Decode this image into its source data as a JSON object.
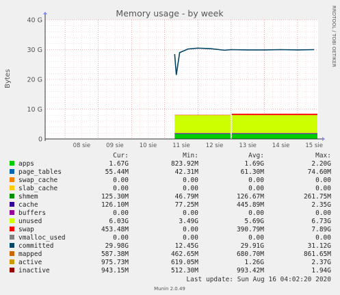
{
  "chart_data": {
    "type": "area",
    "title": "Memory usage - by week",
    "ylabel": "Bytes",
    "side_label": "RRDTOOL / TOBI OETIKER",
    "y_ticks": [
      "0",
      "10 G",
      "20 G",
      "30 G",
      "40 G"
    ],
    "ylim": [
      0,
      40
    ],
    "y_unit": "G",
    "x_ticks": [
      "08 sie",
      "09 sie",
      "10 sie",
      "11 sie",
      "12 sie",
      "13 sie",
      "14 sie",
      "15 sie"
    ],
    "grid": true,
    "stack": [
      {
        "name": "apps",
        "color": "#00cc00",
        "value": 1.67
      },
      {
        "name": "page_tables",
        "color": "#0066b3",
        "value": 0.055
      },
      {
        "name": "swap_cache",
        "color": "#ff8000",
        "value": 0.0
      },
      {
        "name": "slab_cache",
        "color": "#ffcc00",
        "value": 0.0
      },
      {
        "name": "shmem",
        "color": "#330099",
        "value": 0.125
      },
      {
        "name": "cache",
        "color": "#990099",
        "value": 0.126
      },
      {
        "name": "buffers",
        "color": "#ccff00",
        "value": 0.0
      },
      {
        "name": "unused",
        "color": "#ccff00",
        "value": 6.03
      },
      {
        "name": "swap",
        "color": "#ff0000",
        "value": 0.45
      }
    ],
    "committed_line": {
      "name": "committed",
      "color": "#004466",
      "values": [
        {
          "x": 11.3,
          "y": 28.5
        },
        {
          "x": 11.35,
          "y": 21.5
        },
        {
          "x": 11.45,
          "y": 29.0
        },
        {
          "x": 11.7,
          "y": 30.2
        },
        {
          "x": 12.0,
          "y": 30.5
        },
        {
          "x": 12.4,
          "y": 30.3
        },
        {
          "x": 12.8,
          "y": 29.8
        },
        {
          "x": 13.0,
          "y": 30.0
        },
        {
          "x": 13.5,
          "y": 29.9
        },
        {
          "x": 14.0,
          "y": 29.9
        },
        {
          "x": 14.5,
          "y": 30.0
        },
        {
          "x": 15.0,
          "y": 29.9
        },
        {
          "x": 15.5,
          "y": 30.0
        }
      ]
    }
  },
  "legend": {
    "headers": {
      "cur": "Cur:",
      "min": "Min:",
      "avg": "Avg:",
      "max": "Max:"
    },
    "rows": [
      {
        "name": "apps",
        "color": "#00cc00",
        "cur": "1.67G",
        "min": "823.92M",
        "avg": "1.69G",
        "max": "2.20G"
      },
      {
        "name": "page_tables",
        "color": "#0066b3",
        "cur": "55.44M",
        "min": "42.31M",
        "avg": "61.30M",
        "max": "74.60M"
      },
      {
        "name": "swap_cache",
        "color": "#ff8000",
        "cur": "0.00",
        "min": "0.00",
        "avg": "0.00",
        "max": "0.00"
      },
      {
        "name": "slab_cache",
        "color": "#ffcc00",
        "cur": "0.00",
        "min": "0.00",
        "avg": "0.00",
        "max": "0.00"
      },
      {
        "name": "shmem",
        "color": "#008f00",
        "cur": "125.30M",
        "min": "46.79M",
        "avg": "126.67M",
        "max": "261.75M"
      },
      {
        "name": "cache",
        "color": "#330099",
        "cur": "126.10M",
        "min": "77.25M",
        "avg": "445.89M",
        "max": "2.35G"
      },
      {
        "name": "buffers",
        "color": "#990099",
        "cur": "0.00",
        "min": "0.00",
        "avg": "0.00",
        "max": "0.00"
      },
      {
        "name": "unused",
        "color": "#ccff00",
        "cur": "6.03G",
        "min": "3.49G",
        "avg": "5.69G",
        "max": "6.73G"
      },
      {
        "name": "swap",
        "color": "#ff0000",
        "cur": "453.48M",
        "min": "0.00",
        "avg": "390.79M",
        "max": "7.89G"
      },
      {
        "name": "vmalloc_used",
        "color": "#808080",
        "cur": "0.00",
        "min": "0.00",
        "avg": "0.00",
        "max": "0.00"
      },
      {
        "name": "committed",
        "color": "#004466",
        "cur": "29.98G",
        "min": "12.45G",
        "avg": "29.91G",
        "max": "31.12G"
      },
      {
        "name": "mapped",
        "color": "#cc6600",
        "cur": "587.38M",
        "min": "462.65M",
        "avg": "680.70M",
        "max": "861.65M"
      },
      {
        "name": "active",
        "color": "#cc9900",
        "cur": "975.73M",
        "min": "619.05M",
        "avg": "1.26G",
        "max": "2.37G"
      },
      {
        "name": "inactive",
        "color": "#990000",
        "cur": "943.15M",
        "min": "512.30M",
        "avg": "993.42M",
        "max": "1.94G"
      }
    ]
  },
  "last_update": "Last update: Sun Aug 16 04:02:20 2020",
  "footer": "Munin 2.0.49"
}
